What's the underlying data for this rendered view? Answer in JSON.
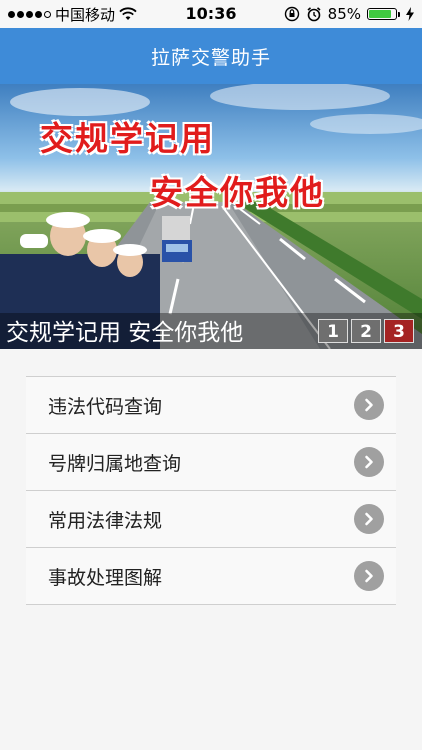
{
  "status_bar": {
    "carrier": "中国移动",
    "time": "10:36",
    "battery_percent": "85%",
    "battery_level": 0.85,
    "icons": [
      "signal-dots-icon",
      "wifi-icon",
      "rotation-lock-icon",
      "alarm-icon",
      "battery-icon",
      "charging-icon"
    ]
  },
  "nav": {
    "title": "拉萨交警助手"
  },
  "banner": {
    "headline_line1": "交规学记用",
    "headline_line2": "安全你我他",
    "caption": "交规学记用 安全你我他",
    "pages": [
      "1",
      "2",
      "3"
    ],
    "active_page": "3"
  },
  "menu": {
    "items": [
      {
        "label": "违法代码查询",
        "icon": "chevron-right-icon"
      },
      {
        "label": "号牌归属地查询",
        "icon": "chevron-right-icon"
      },
      {
        "label": "常用法律法规",
        "icon": "chevron-right-icon"
      },
      {
        "label": "事故处理图解",
        "icon": "chevron-right-icon"
      }
    ]
  },
  "colors": {
    "nav_background": "#3e8bd8",
    "headline": "#e11c1c",
    "active_page": "#a52323",
    "battery_fill": "#3fc93f"
  }
}
